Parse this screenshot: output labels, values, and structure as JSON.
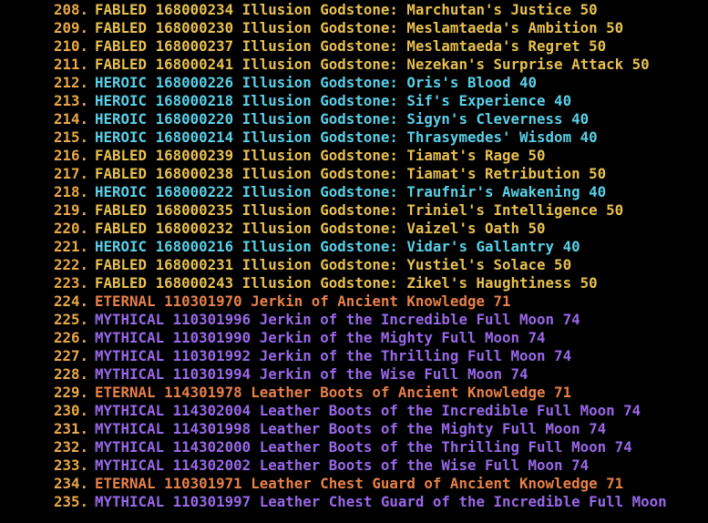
{
  "colors": {
    "number": "#e8a848",
    "FABLED": "#e8c050",
    "HEROIC": "#58d0e8",
    "ETERNAL": "#e88048",
    "MYTHICAL": "#9868e8"
  },
  "lines": [
    {
      "num": "208.",
      "rarity": "FABLED",
      "text": "FABLED 168000234 Illusion Godstone: Marchutan's Justice 50"
    },
    {
      "num": "209.",
      "rarity": "FABLED",
      "text": "FABLED 168000230 Illusion Godstone: Meslamtaeda's Ambition 50"
    },
    {
      "num": "210.",
      "rarity": "FABLED",
      "text": "FABLED 168000237 Illusion Godstone: Meslamtaeda's Regret 50"
    },
    {
      "num": "211.",
      "rarity": "FABLED",
      "text": "FABLED 168000241 Illusion Godstone: Nezekan's Surprise Attack 50"
    },
    {
      "num": "212.",
      "rarity": "HEROIC",
      "text": "HEROIC 168000226 Illusion Godstone: Oris's Blood 40"
    },
    {
      "num": "213.",
      "rarity": "HEROIC",
      "text": "HEROIC 168000218 Illusion Godstone: Sif's Experience 40"
    },
    {
      "num": "214.",
      "rarity": "HEROIC",
      "text": "HEROIC 168000220 Illusion Godstone: Sigyn's Cleverness 40"
    },
    {
      "num": "215.",
      "rarity": "HEROIC",
      "text": "HEROIC 168000214 Illusion Godstone: Thrasymedes' Wisdom 40"
    },
    {
      "num": "216.",
      "rarity": "FABLED",
      "text": "FABLED 168000239 Illusion Godstone: Tiamat's Rage 50"
    },
    {
      "num": "217.",
      "rarity": "FABLED",
      "text": "FABLED 168000238 Illusion Godstone: Tiamat's Retribution 50"
    },
    {
      "num": "218.",
      "rarity": "HEROIC",
      "text": "HEROIC 168000222 Illusion Godstone: Traufnir's Awakening 40"
    },
    {
      "num": "219.",
      "rarity": "FABLED",
      "text": "FABLED 168000235 Illusion Godstone: Triniel's Intelligence 50"
    },
    {
      "num": "220.",
      "rarity": "FABLED",
      "text": "FABLED 168000232 Illusion Godstone: Vaizel's Oath 50"
    },
    {
      "num": "221.",
      "rarity": "HEROIC",
      "text": "HEROIC 168000216 Illusion Godstone: Vidar's Gallantry 40"
    },
    {
      "num": "222.",
      "rarity": "FABLED",
      "text": "FABLED 168000231 Illusion Godstone: Yustiel's Solace 50"
    },
    {
      "num": "223.",
      "rarity": "FABLED",
      "text": "FABLED 168000243 Illusion Godstone: Zikel's Haughtiness 50"
    },
    {
      "num": "224.",
      "rarity": "ETERNAL",
      "text": "ETERNAL 110301970 Jerkin of Ancient Knowledge 71"
    },
    {
      "num": "225.",
      "rarity": "MYTHICAL",
      "text": "MYTHICAL 110301996 Jerkin of the Incredible Full Moon 74"
    },
    {
      "num": "226.",
      "rarity": "MYTHICAL",
      "text": "MYTHICAL 110301990 Jerkin of the Mighty Full Moon 74"
    },
    {
      "num": "227.",
      "rarity": "MYTHICAL",
      "text": "MYTHICAL 110301992 Jerkin of the Thrilling Full Moon 74"
    },
    {
      "num": "228.",
      "rarity": "MYTHICAL",
      "text": "MYTHICAL 110301994 Jerkin of the Wise Full Moon 74"
    },
    {
      "num": "229.",
      "rarity": "ETERNAL",
      "text": "ETERNAL 114301978 Leather Boots of Ancient Knowledge 71"
    },
    {
      "num": "230.",
      "rarity": "MYTHICAL",
      "text": "MYTHICAL 114302004 Leather Boots of the Incredible Full Moon 74"
    },
    {
      "num": "231.",
      "rarity": "MYTHICAL",
      "text": "MYTHICAL 114301998 Leather Boots of the Mighty Full Moon 74"
    },
    {
      "num": "232.",
      "rarity": "MYTHICAL",
      "text": "MYTHICAL 114302000 Leather Boots of the Thrilling Full Moon 74"
    },
    {
      "num": "233.",
      "rarity": "MYTHICAL",
      "text": "MYTHICAL 114302002 Leather Boots of the Wise Full Moon 74"
    },
    {
      "num": "234.",
      "rarity": "ETERNAL",
      "text": "ETERNAL 110301971 Leather Chest Guard of Ancient Knowledge 71"
    },
    {
      "num": "235.",
      "rarity": "MYTHICAL",
      "text": "MYTHICAL 110301997 Leather Chest Guard of the Incredible Full Moon"
    }
  ]
}
